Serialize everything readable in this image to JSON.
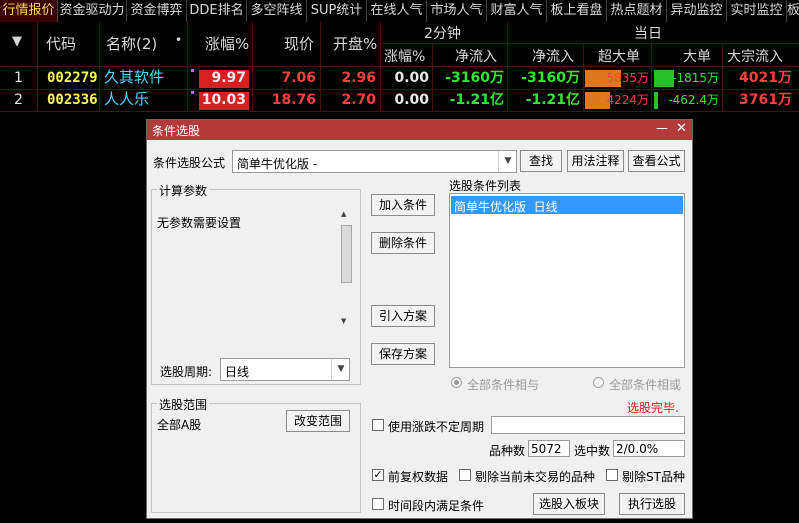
{
  "tabs": [
    "行情报价",
    "资金驱动力",
    "资金博弈",
    "DDE排名",
    "多空阵线",
    "SUP统计",
    "在线人气",
    "市场人气",
    "财富人气",
    "板上看盘",
    "热点题材",
    "异动监控",
    "实时监控",
    "板"
  ],
  "header": {
    "group_2min": "2分钟",
    "group_today": "当日",
    "sort_icon": "▼",
    "columns": [
      "代码",
      "名称(2)",
      "涨幅%",
      "现价",
      "开盘%",
      "涨幅%",
      "净流入",
      "净流入",
      "超大单",
      "大单",
      "大宗流入"
    ]
  },
  "rows": [
    {
      "idx": "1",
      "code": "002279",
      "name": "久其软件",
      "change": "9.97",
      "price": "7.06",
      "open": "2.96",
      "chg2": "0.00",
      "net2": "-3160万",
      "net": "-3160万",
      "super": "5835万",
      "big": "-1815万",
      "block": "4021万",
      "super_frac": 0.55,
      "big_frac": 0.3
    },
    {
      "idx": "2",
      "code": "002336",
      "name": "人人乐",
      "change": "10.03",
      "price": "18.76",
      "open": "2.70",
      "chg2": "0.00",
      "net2": "-1.21亿",
      "net": "-1.21亿",
      "super": "4224万",
      "big": "-462.4万",
      "block": "3761万",
      "super_frac": 0.38,
      "big_frac": 0.06
    }
  ],
  "dialog": {
    "title": "条件选股",
    "formula_label": "条件选股公式",
    "formula_value": "简单牛优化版 -",
    "btn_find": "查找",
    "btn_usage": "用法注释",
    "btn_view": "查看公式",
    "params_group": "计算参数",
    "params_text": "无参数需要设置",
    "period_label": "选股周期:",
    "period_value": "日线",
    "range_group": "选股范围",
    "range_value": "全部A股",
    "btn_change_range": "改变范围",
    "btn_add": "加入条件",
    "btn_delete": "删除条件",
    "btn_import": "引入方案",
    "btn_save": "保存方案",
    "list_label": "选股条件列表",
    "list_items": [
      "简单牛优化版  日线"
    ],
    "radio_and": "全部条件相与",
    "radio_or": "全部条件相或",
    "status": "选股完毕.",
    "chk_period": "使用涨跌不定周期",
    "count_label": "品种数",
    "count_value": "5072",
    "selected_label": "选中数",
    "selected_value": "2/0.0%",
    "chk_adjust": "前复权数据",
    "chk_remove_untraded": "剔除当前未交易的品种",
    "chk_remove_st": "剔除ST品种",
    "chk_time": "时间段内满足条件",
    "btn_to_block": "选股入板块",
    "btn_execute": "执行选股",
    "minimize_icon": "—",
    "close_icon": "✕",
    "dropdown_icon": "▼",
    "check_mark": "✓"
  },
  "colors": {
    "accent": "#b43a3a",
    "up": "#ff4040",
    "down": "#30e830",
    "code": "#ffff54",
    "name": "#4ad6ff"
  }
}
